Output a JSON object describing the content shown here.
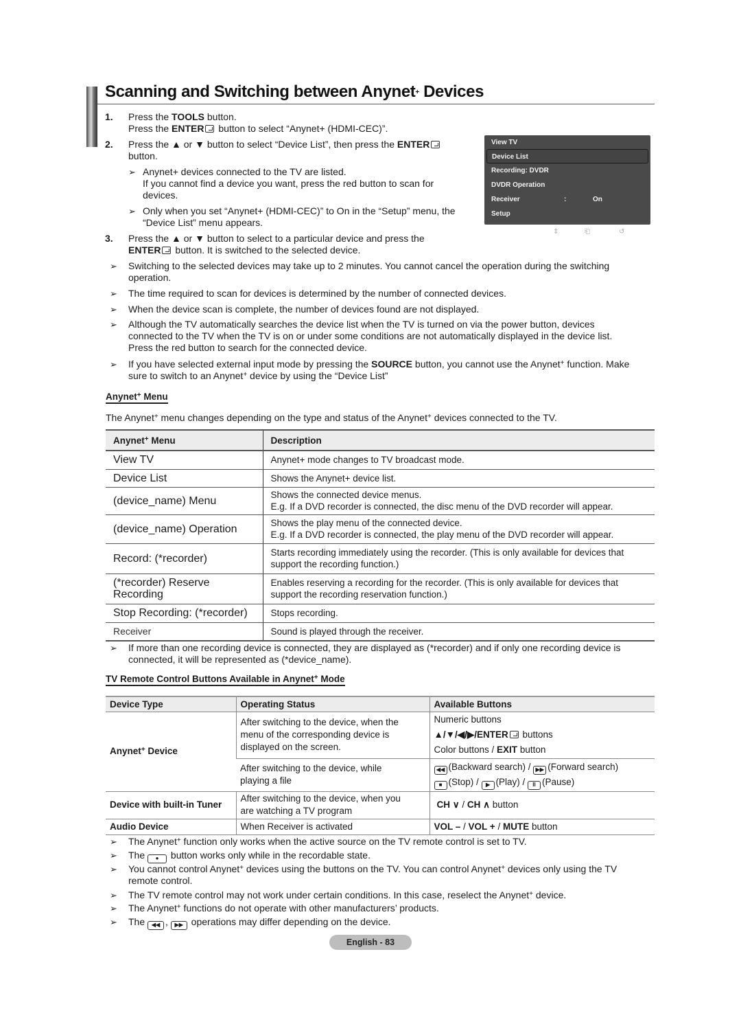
{
  "page": {
    "title": "Scanning and Switching between Anynet",
    "title_sup": "+",
    "title_end": " Devices",
    "page_label": "English - 83"
  },
  "steps": [
    {
      "num": "1.",
      "lines": [
        {
          "pre": "Press the ",
          "bold": "TOOLS",
          "post": " button."
        },
        {
          "pre": "Press the ",
          "bold": "ENTER",
          "icon": true,
          "post": " button to select “Anynet+ (HDMI-CEC)”."
        }
      ]
    },
    {
      "num": "2.",
      "lines": [
        {
          "pre": "Press the ▲ or ▼ button to select “Device List”, then press the ",
          "bold": "ENTER",
          "icon": true,
          "post": ""
        },
        {
          "pre": "button.",
          "bold": "",
          "post": ""
        }
      ],
      "notes": [
        {
          "lines": [
            "Anynet+ devices connected to the TV are listed.",
            "If you cannot find a device you want, press the red button to scan for",
            "devices."
          ]
        },
        {
          "lines": [
            "Only when you set “Anynet+ (HDMI-CEC)” to On in the “Setup” menu, the",
            "“Device List” menu appears."
          ]
        }
      ]
    },
    {
      "num": "3.",
      "lines": [
        {
          "pre": "Press the ▲ or ▼ button to select to a particular device and press the",
          "bold": "",
          "post": ""
        },
        {
          "pre": "",
          "bold": "ENTER",
          "icon": true,
          "post": " button. It is switched to the selected device."
        }
      ]
    }
  ],
  "tv_menu": {
    "items": [
      "View TV",
      "Device List",
      "Recording: DVDR",
      "DVDR Operation",
      "Receiver",
      "Setup"
    ],
    "selected": "Device List",
    "receiver_colon": ":",
    "receiver_value": "On",
    "hints": {
      "move": "⇕",
      "enter": "⎗",
      "return": "↺"
    }
  },
  "general_notes": [
    [
      "Switching to the selected devices may take up to 2 minutes. You cannot cancel the operation during the switching",
      "operation."
    ],
    [
      "The time required to scan for devices is determined by the number of connected devices."
    ],
    [
      "When the device scan is complete, the number of devices found are not displayed."
    ],
    [
      "Although the TV automatically searches the device list when the TV is turned on via the power button, devices",
      "connected to the TV when the TV is on or under some conditions are not automatically displayed in the device list.",
      "Press the red button to search for the connected device."
    ]
  ],
  "source_note": {
    "l1_pre": "If you have selected external input mode by pressing the ",
    "l1_bold": "SOURCE",
    "l1_mid": " button, you cannot use the Anynet",
    "l1_post": " function. Make",
    "l2_pre": "sure to switch to an Anynet",
    "l2_post": " device by using the “Device List”"
  },
  "anynet_menu_section": {
    "heading": "Anynet",
    "heading_post": " Menu",
    "intro_pre": "The Anynet",
    "intro_mid": " menu changes depending on the type and status of the Anynet",
    "intro_post": " devices connected to the TV.",
    "columns": [
      "Anynet",
      " Menu",
      "Description"
    ],
    "rows": [
      {
        "menu": "View TV",
        "desc": [
          "Anynet+ mode changes to TV broadcast mode."
        ]
      },
      {
        "menu": "Device List",
        "desc": [
          "Shows the Anynet+ device list."
        ]
      },
      {
        "menu": "(device_name) Menu",
        "desc": [
          "Shows the connected device menus.",
          "E.g. If a DVD recorder is connected, the disc menu of the DVD recorder will appear."
        ]
      },
      {
        "menu": "(device_name) Operation",
        "desc": [
          "Shows the play menu of the connected device.",
          "E.g. If a DVD recorder is connected, the play menu of the DVD recorder will appear."
        ]
      },
      {
        "menu": "Record: (*recorder)",
        "desc": [
          "Starts recording immediately using the recorder. (This is only available for devices that",
          "support the recording function.)"
        ]
      },
      {
        "menu": "(*recorder) Reserve Recording",
        "desc": [
          "Enables reserving a recording for the recorder. (This is only available for devices that",
          "support the recording reservation function.)"
        ]
      },
      {
        "menu": "Stop Recording: (*recorder)",
        "desc": [
          "Stops recording."
        ]
      },
      {
        "menu": "Receiver",
        "desc": [
          "Sound is played through the receiver."
        ]
      }
    ],
    "footnote": [
      "If more than one recording device is connected, they are displayed as (*recorder) and if only one recording device is",
      "connected, it will be represented as (*device_name)."
    ]
  },
  "remote_section": {
    "heading": "TV Remote Control Buttons Available in Anynet",
    "heading_post": " Mode",
    "columns": [
      "Device Type",
      "Operating Status",
      "Available Buttons"
    ],
    "rows": {
      "anynet_device": {
        "type": "Anynet",
        "type_post": " Device",
        "status1": [
          "After switching to the device, when the",
          "menu of the corresponding device is",
          "displayed on the screen."
        ],
        "buttons1": [
          "Numeric buttons",
          "▲/▼/◀/▶/ENTER",
          " buttons",
          "Color buttons / ",
          "EXIT",
          " button"
        ],
        "status2": [
          "After switching to the device, while",
          "playing a file"
        ],
        "buttons2": {
          "rew": "(Backward search) / ",
          "ff": "(Forward search)",
          "stop": "(Stop) / ",
          "play": "(Play) / ",
          "pause": "(Pause)"
        }
      },
      "tuner": {
        "type": "Device with built-in Tuner",
        "status": [
          "After switching to the device, when you",
          "are watching a TV program"
        ],
        "buttons_a": "CH ∨",
        "buttons_b": " / ",
        "buttons_c": "CH ∧",
        "buttons_d": " button"
      },
      "audio": {
        "type": "Audio Device",
        "status": "When Receiver is activated",
        "b1": "VOL –",
        "s1": " / ",
        "b2": "VOL +",
        "s2": " / ",
        "b3": "MUTE",
        "s3": " button"
      }
    }
  },
  "final_notes": {
    "n1_pre": "The Anynet",
    "n1_post": " function only works when the active source on the TV remote control is set to TV.",
    "n2_pre": "The ",
    "n2_post": " button works only while in the recordable state.",
    "n3_l1_pre": "You cannot control Anynet",
    "n3_l1_mid": " devices using the buttons on the TV. You can control Anynet",
    "n3_l1_post": " devices only using the TV",
    "n3_l2": "remote control.",
    "n4_pre": "The TV remote control may not work under certain conditions. In this case, reselect the Anynet",
    "n4_post": " device.",
    "n5_pre": "The Anynet",
    "n5_post": " functions do not operate with other manufacturers’ products.",
    "n6_pre": "The ",
    "n6_mid": ", ",
    "n6_post": " operations may differ depending on the device."
  },
  "symbols": {
    "plus": "+",
    "arrow": "➢",
    "rew": "◀◀",
    "ff": "▶▶",
    "stop": "■",
    "play": "▶",
    "pause": "II",
    "rec": "●"
  }
}
